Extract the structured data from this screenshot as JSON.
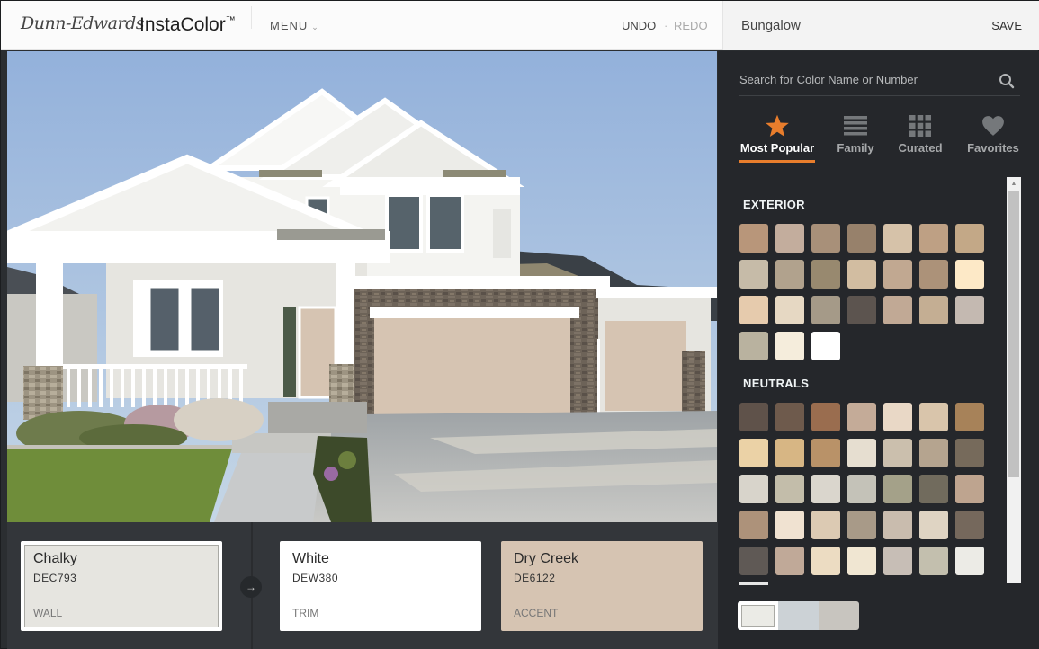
{
  "header": {
    "brand": "Dunn-Edwards",
    "product": "InstaColor",
    "trademark": "™",
    "menu_label": "MENU",
    "menu_chevron": "⌄",
    "undo_label": "UNDO",
    "separator": "·",
    "redo_label": "REDO",
    "project_name": "Bungalow",
    "save_label": "SAVE"
  },
  "photo": {
    "subject": "two-story white craftsman house with three-car garage",
    "colors": {
      "wall": "#e7e6e1",
      "trim": "#ffffff",
      "accent": "#d6c4b3",
      "stone": "#6c6257",
      "roof": "#3a4046",
      "sky": "#a6c0e1",
      "lawn": "#6f8d3a",
      "concrete": "#b8bcbf"
    }
  },
  "selection": {
    "arrow_icon": "→",
    "cards": [
      {
        "name": "Chalky",
        "code": "DEC793",
        "role": "WALL",
        "color": "#e6e5e0",
        "selected": true
      },
      {
        "name": "White",
        "code": "DEW380",
        "role": "TRIM",
        "color": "#ffffff",
        "selected": false
      },
      {
        "name": "Dry Creek",
        "code": "DE6122",
        "role": "ACCENT",
        "color": "#d6c4b2",
        "selected": false
      }
    ]
  },
  "sidebar": {
    "search": {
      "placeholder": "Search for Color Name or Number",
      "value": ""
    },
    "accent_color": "#e87d2c",
    "tabs": [
      {
        "label": "Most Popular",
        "icon": "star-icon",
        "active": true
      },
      {
        "label": "Family",
        "icon": "list-icon",
        "active": false
      },
      {
        "label": "Curated",
        "icon": "grid-icon",
        "active": false
      },
      {
        "label": "Favorites",
        "icon": "heart-icon",
        "active": false
      }
    ],
    "sections": [
      {
        "title": "EXTERIOR",
        "swatches": [
          "#b8967a",
          "#c3ad9d",
          "#a89079",
          "#97816b",
          "#d6c2a9",
          "#bea084",
          "#c3a887",
          "#c6bba8",
          "#b1a28d",
          "#98896f",
          "#d2bda1",
          "#c1a891",
          "#ac9279",
          "#fde9c7",
          "#e6cbad",
          "#e6d8c3",
          "#a59a88",
          "#5c544f",
          "#c1a995",
          "#c4ae93",
          "#c4b9b1",
          "#b9b29f",
          "#f5eddc",
          "#ffffff"
        ]
      },
      {
        "title": "NEUTRALS",
        "swatches": [
          "#5f524a",
          "#6e5a4c",
          "#9a6d4f",
          "#c4ab98",
          "#e9d8c6",
          "#d9c5ab",
          "#a78259",
          "#ebd2a6",
          "#d7b684",
          "#b99268",
          "#e6ded0",
          "#cbbfad",
          "#b5a48f",
          "#766a5b",
          "#d8d4cb",
          "#c3bdaa",
          "#dad6cd",
          "#c4c2b8",
          "#a4a189",
          "#716b5d",
          "#bea48f",
          "#ad927a",
          "#f0e2d1",
          "#dccab3",
          "#a89a88",
          "#c9bcae",
          "#dfd4c3",
          "#75685c",
          "#5f5955",
          "#c0a998",
          "#ecdcc2",
          "#f0e6d2",
          "#c7beb6",
          "#c3bfae",
          "#ecebe6"
        ]
      }
    ],
    "scroll_position": 0,
    "recent": [
      "#ebebe6",
      "#ccd2d6",
      "#c8c5bf"
    ]
  }
}
